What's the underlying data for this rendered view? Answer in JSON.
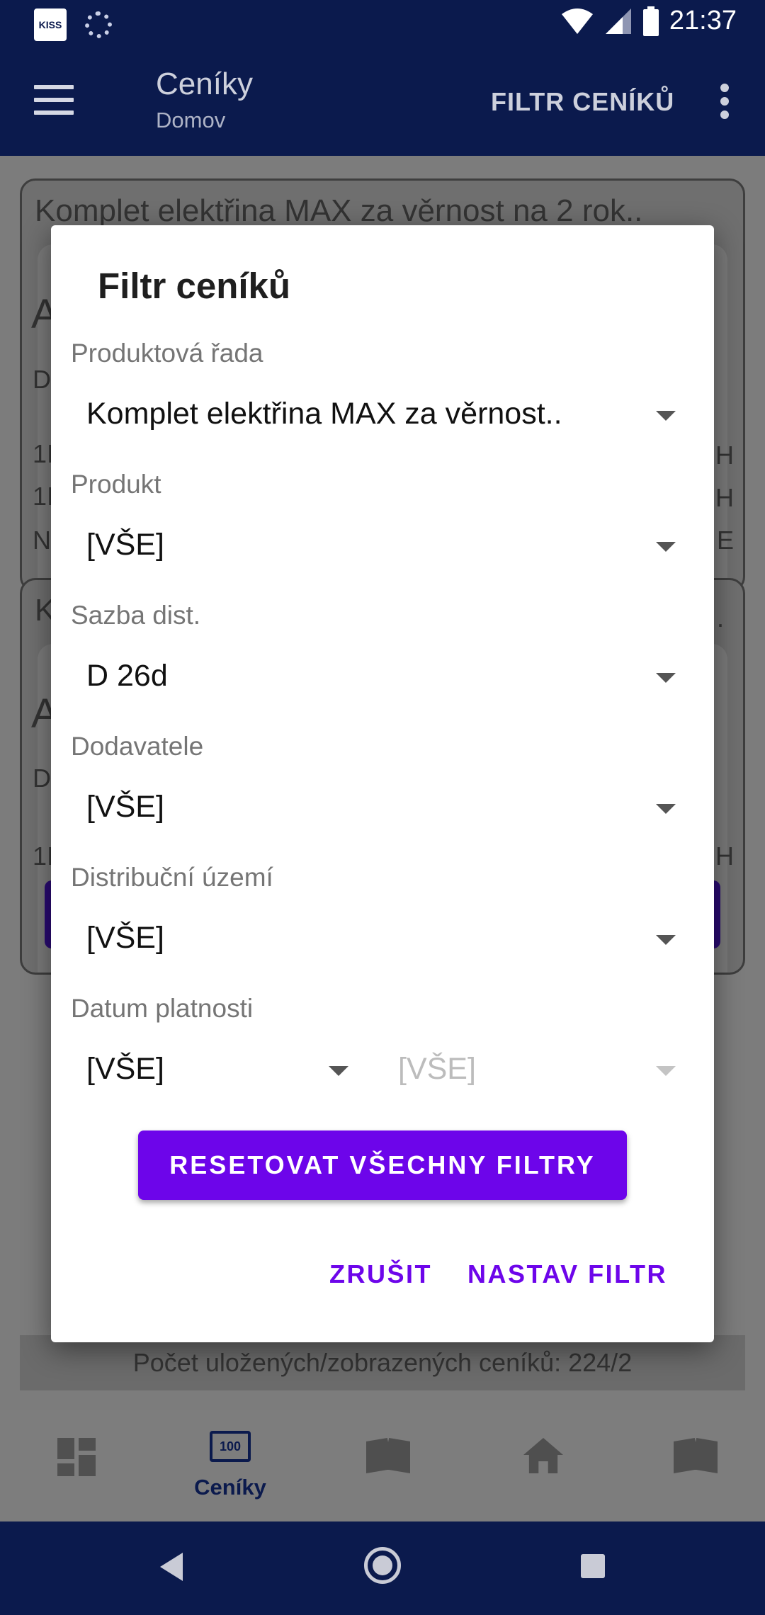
{
  "status_bar": {
    "time": "21:37",
    "app_icon_text": "KISS"
  },
  "app_bar": {
    "title": "Ceníky",
    "subtitle": "Domov",
    "action_label": "FILTR CENÍKŮ"
  },
  "background": {
    "card1_title": "Komplet elektřina MAX za věrnost na 2 rok..",
    "card2_title_fragment": "K",
    "edge_letters": [
      "A",
      "D",
      "1I",
      "1I",
      "N",
      "A",
      "D",
      "1I"
    ],
    "edge_letters_right": [
      "H",
      "H",
      "E",
      ".",
      "H"
    ],
    "count_text": "Počet uložených/zobrazených ceníků: 224/2"
  },
  "bottom_nav": {
    "items": [
      {
        "icon": "dashboard-icon",
        "label": ""
      },
      {
        "icon": "price-list-icon",
        "label": "Ceníky",
        "glyph": "100"
      },
      {
        "icon": "book-icon",
        "label": ""
      },
      {
        "icon": "home-icon",
        "label": ""
      },
      {
        "icon": "map-book-icon",
        "label": ""
      }
    ]
  },
  "dialog": {
    "title": "Filtr ceníků",
    "fields": {
      "product_line": {
        "label": "Produktová řada",
        "value": "Komplet elektřina MAX za věrnost.."
      },
      "product": {
        "label": "Produkt",
        "value": "[VŠE]"
      },
      "dist_rate": {
        "label": "Sazba dist.",
        "value": "D 26d"
      },
      "suppliers": {
        "label": "Dodavatele",
        "value": "[VŠE]"
      },
      "dist_area": {
        "label": "Distribuční území",
        "value": "[VŠE]"
      },
      "valid_date": {
        "label": "Datum platnosti",
        "value_from": "[VŠE]",
        "value_to": "[VŠE]"
      }
    },
    "reset_label": "RESETOVAT VŠECHNY FILTRY",
    "cancel_label": "ZRUŠIT",
    "apply_label": "NASTAV FILTR"
  },
  "colors": {
    "primary_dark": "#0b1a4d",
    "accent": "#6d05ea"
  }
}
